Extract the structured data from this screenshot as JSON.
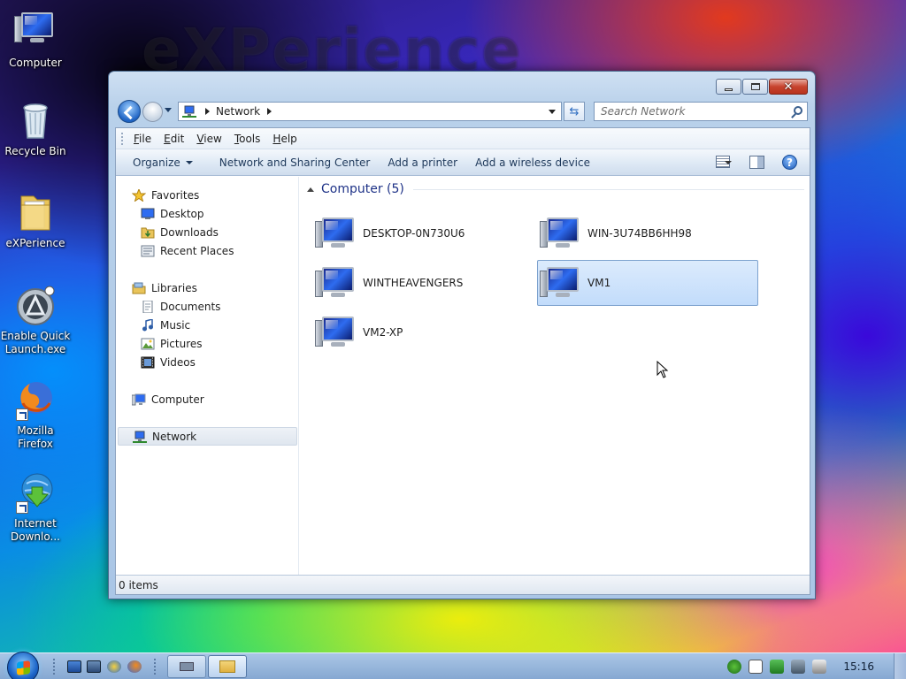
{
  "wallpaper": {
    "brand_text": "eXPerience"
  },
  "desktop": {
    "icons": [
      {
        "label": "Computer"
      },
      {
        "label": "Recycle Bin"
      },
      {
        "label": "eXPerience"
      },
      {
        "label": "Enable Quick Launch.exe"
      },
      {
        "label": "Mozilla Firefox"
      },
      {
        "label": "Internet Downlo..."
      }
    ]
  },
  "window": {
    "address": {
      "crumb": "Network"
    },
    "search": {
      "placeholder": "Search Network"
    },
    "menu": [
      "File",
      "Edit",
      "View",
      "Tools",
      "Help"
    ],
    "commands": {
      "organize": "Organize",
      "sharing_center": "Network and Sharing Center",
      "add_printer": "Add a printer",
      "add_wireless": "Add a wireless device"
    },
    "nav": {
      "favorites": "Favorites",
      "desktop": "Desktop",
      "downloads": "Downloads",
      "recent": "Recent Places",
      "libraries": "Libraries",
      "documents": "Documents",
      "music": "Music",
      "pictures": "Pictures",
      "videos": "Videos",
      "computer": "Computer",
      "network": "Network"
    },
    "group_header": "Computer (5)",
    "computers": [
      "DESKTOP-0N730U6",
      "WIN-3U74BB6HH98",
      "WINTHEAVENGERS",
      "VM1",
      "VM2-XP"
    ],
    "selected_computer": "VM1",
    "status": "0 items"
  },
  "taskbar": {
    "clock": "15:16"
  },
  "colors": {
    "accent": "#1e3287",
    "selection": "#c2dcfb",
    "titlebar": "#b9d1ea"
  }
}
